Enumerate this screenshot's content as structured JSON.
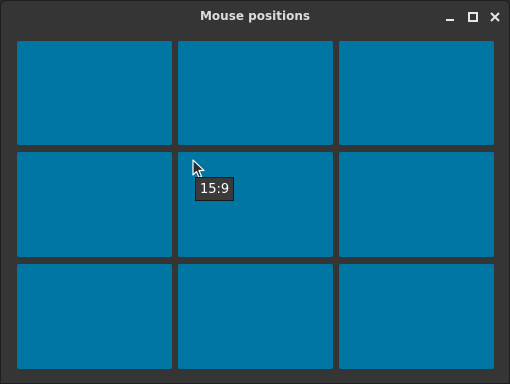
{
  "window": {
    "title": "Mouse positions"
  },
  "titlebar_buttons": [
    {
      "name": "minimize",
      "icon": "minimize-icon"
    },
    {
      "name": "maximize",
      "icon": "maximize-icon"
    },
    {
      "name": "close",
      "icon": "close-icon"
    }
  ],
  "grid": {
    "rows": 3,
    "columns": 3,
    "cell_color": "#0077a3"
  },
  "tooltip": {
    "text": "15:9"
  },
  "cursor": {
    "icon": "arrow-cursor-icon"
  }
}
